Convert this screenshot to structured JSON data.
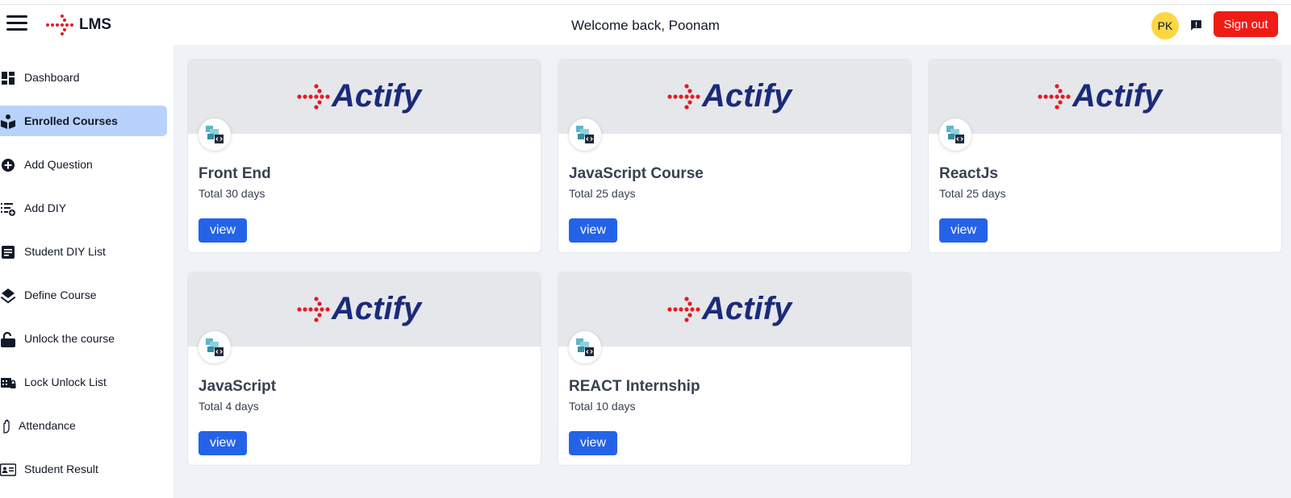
{
  "app": {
    "name": "LMS"
  },
  "header": {
    "welcome": "Welcome back, Poonam",
    "avatar_initials": "PK",
    "signout_label": "Sign out"
  },
  "sidebar": {
    "items": [
      {
        "label": "Dashboard",
        "icon": "dashboard-icon",
        "active": false
      },
      {
        "label": "Enrolled Courses",
        "icon": "reader-book-icon",
        "active": true
      },
      {
        "label": "Add Question",
        "icon": "add-circle-icon",
        "active": false
      },
      {
        "label": "Add DIY",
        "icon": "playlist-add-icon",
        "active": false
      },
      {
        "label": "Student DIY List",
        "icon": "document-list-icon",
        "active": false
      },
      {
        "label": "Define Course",
        "icon": "layers-icon",
        "active": false
      },
      {
        "label": "Unlock the course",
        "icon": "unlock-icon",
        "active": false
      },
      {
        "label": "Lock Unlock List",
        "icon": "grid-lock-icon",
        "active": false
      },
      {
        "label": "Attendance",
        "icon": "hand-icon",
        "active": false
      },
      {
        "label": "Student Result",
        "icon": "id-card-icon",
        "active": false
      }
    ]
  },
  "courses": [
    {
      "banner_text": "Actify",
      "title": "Front End",
      "duration": "Total 30 days",
      "button": "view"
    },
    {
      "banner_text": "Actify",
      "title": "JavaScript Course",
      "duration": "Total 25 days",
      "button": "view"
    },
    {
      "banner_text": "Actify",
      "title": "ReactJs",
      "duration": "Total 25 days",
      "button": "view"
    },
    {
      "banner_text": "Actify",
      "title": "JavaScript",
      "duration": "Total 4 days",
      "button": "view"
    },
    {
      "banner_text": "Actify",
      "title": "REACT Internship",
      "duration": "Total 10 days",
      "button": "view"
    }
  ],
  "colors": {
    "accent": "#2463e8",
    "signout": "#ef1c16",
    "active_nav": "#b9d2fb",
    "avatar": "#fbd743",
    "brand_red": "#e31b23",
    "brand_navy": "#1b2a7a"
  }
}
